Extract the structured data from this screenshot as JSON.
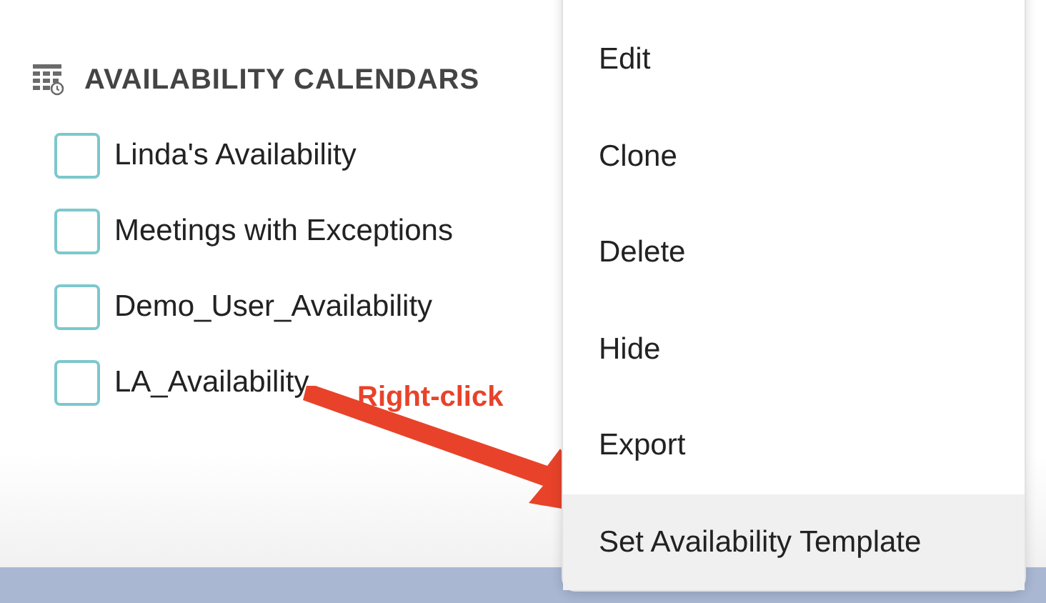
{
  "section": {
    "title": "AVAILABILITY CALENDARS"
  },
  "calendars": [
    {
      "label": "Linda's Availability",
      "checked": false
    },
    {
      "label": "Meetings with Exceptions",
      "checked": false
    },
    {
      "label": "Demo_User_Availability",
      "checked": false
    },
    {
      "label": "LA_Availability",
      "checked": false
    }
  ],
  "context_menu": {
    "items": [
      {
        "label": "Edit",
        "selected": false
      },
      {
        "label": "Clone",
        "selected": false
      },
      {
        "label": "Delete",
        "selected": false
      },
      {
        "label": "Hide",
        "selected": false
      },
      {
        "label": "Export",
        "selected": false
      },
      {
        "label": "Set Availability Template",
        "selected": true
      }
    ]
  },
  "annotation": {
    "label": "Right-click"
  }
}
